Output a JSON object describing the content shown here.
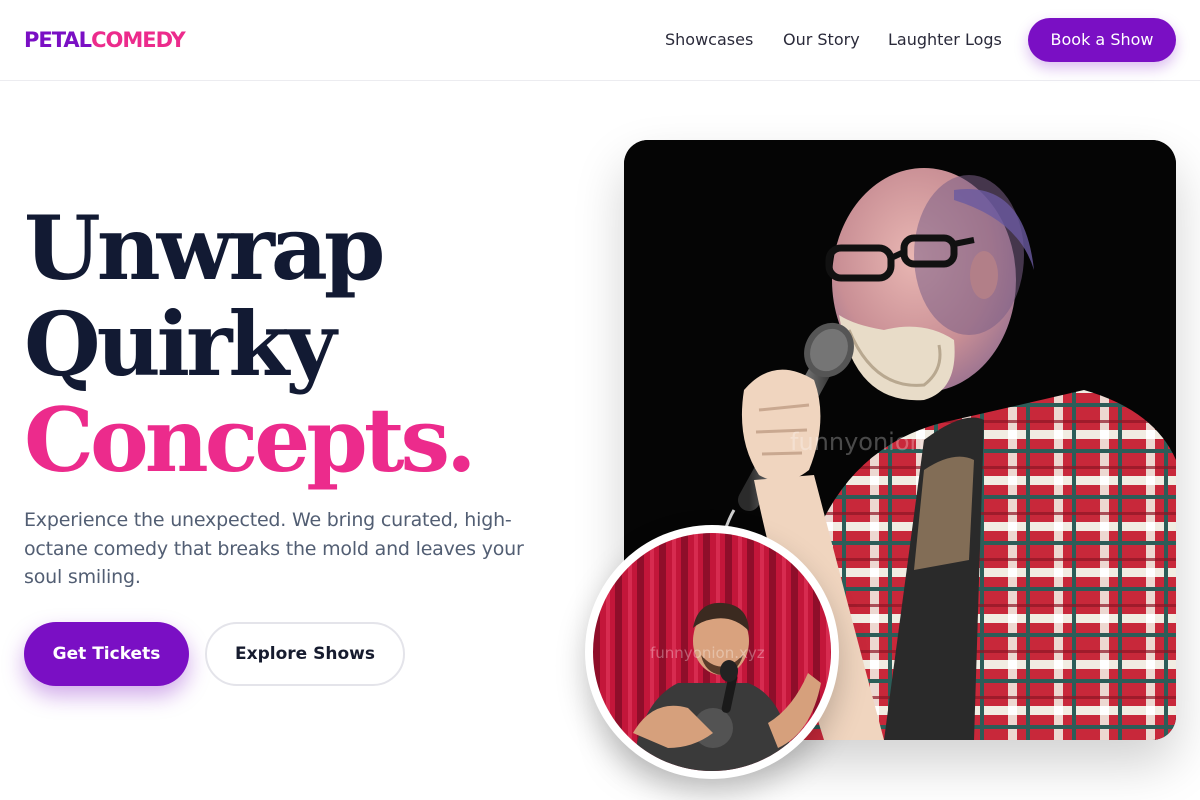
{
  "brand": {
    "part1": "PETAL",
    "part2": "COMEDY"
  },
  "nav": {
    "items": [
      {
        "label": "Showcases"
      },
      {
        "label": "Our Story"
      },
      {
        "label": "Laughter Logs"
      }
    ],
    "cta_label": "Book a Show"
  },
  "hero": {
    "headline": [
      "Unwrap",
      "Quirky",
      "Concepts."
    ],
    "lead": "Experience the unexpected. We bring curated, high-octane comedy that breaks the mold and leaves your soul smiling.",
    "primary_button": "Get Tickets",
    "secondary_button": "Explore Shows"
  },
  "images": {
    "main_watermark": "funnyonion",
    "inset_watermark": "funnyonion.xyz"
  },
  "colors": {
    "brand_purple": "#7a0fc4",
    "brand_pink": "#ec2b8c",
    "heading": "#121a33",
    "body_text": "#525e73"
  }
}
